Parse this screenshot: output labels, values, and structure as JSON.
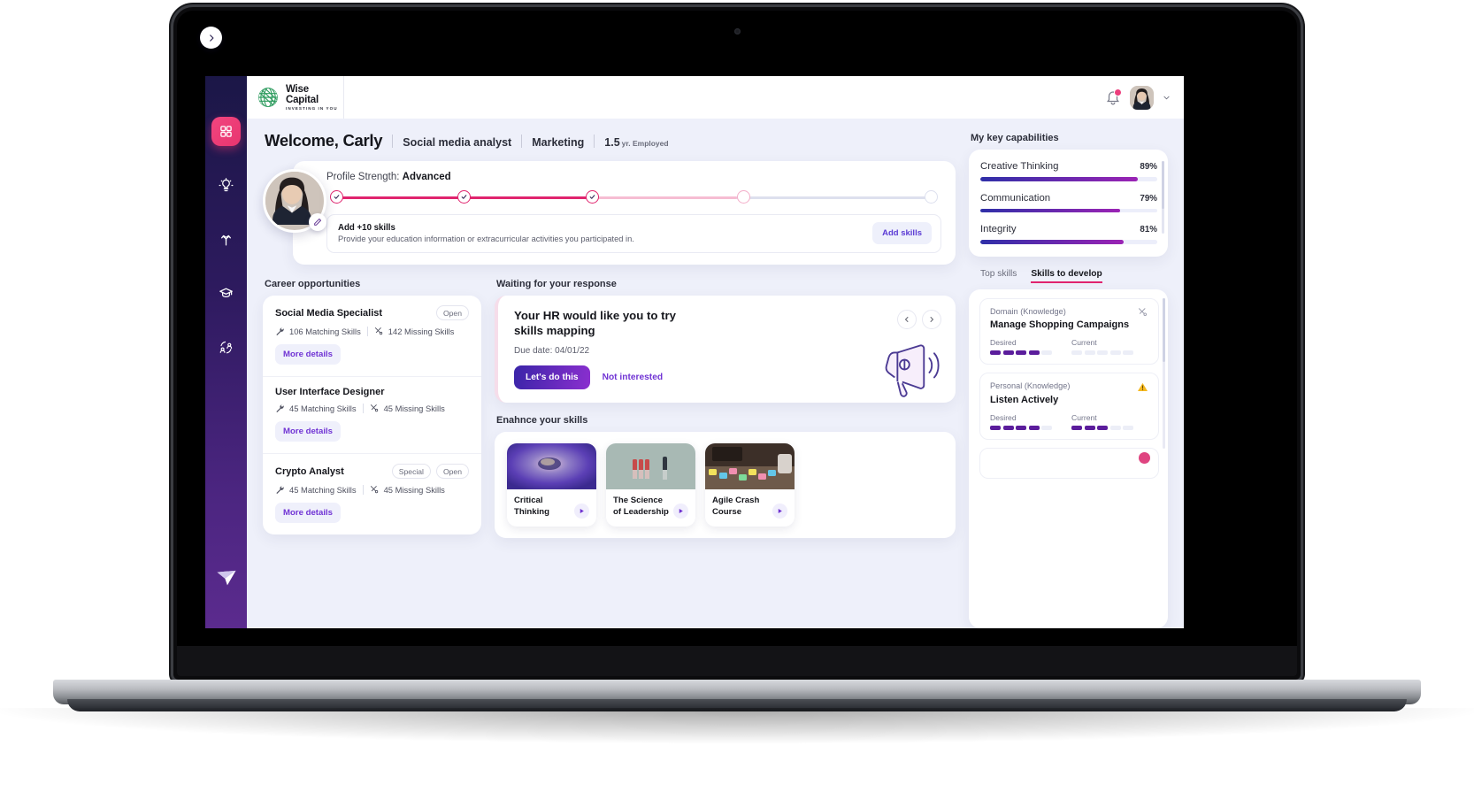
{
  "brand": {
    "name": "Wise Capital",
    "tagline": "INVESTING IN YOU"
  },
  "sidebar": {
    "items": [
      {
        "name": "dashboard",
        "icon": "grid-icon",
        "active": true
      },
      {
        "name": "insights",
        "icon": "lightbulb-icon",
        "active": false
      },
      {
        "name": "career-paths",
        "icon": "branch-icon",
        "active": false
      },
      {
        "name": "learning",
        "icon": "graduation-cap-icon",
        "active": false
      },
      {
        "name": "network",
        "icon": "people-network-icon",
        "active": false
      }
    ],
    "logo_icon": "send-logo-icon",
    "collapse_icon": "chevron-right-icon"
  },
  "header": {
    "notification_icon": "bell-icon",
    "has_notification": true,
    "avatar_icon": "user-avatar",
    "chevron_icon": "chevron-down-icon"
  },
  "welcome": {
    "greeting": "Welcome, Carly",
    "role": "Social media analyst",
    "department": "Marketing",
    "tenure_value": "1.5",
    "tenure_label": "yr. Employed"
  },
  "profile_strength": {
    "label": "Profile Strength:",
    "level": "Advanced",
    "steps": [
      {
        "state": "done"
      },
      {
        "state": "done"
      },
      {
        "state": "done"
      },
      {
        "state": "next"
      },
      {
        "state": "todo"
      }
    ],
    "prompt_title": "Add +10 skills",
    "prompt_text": "Provide your education information or extracurricular activities you participated in.",
    "cta": "Add skills",
    "edit_icon": "pencil-icon"
  },
  "career": {
    "section_title": "Career opportunities",
    "jobs": [
      {
        "title": "Social Media Specialist",
        "badges": [
          "Open"
        ],
        "matching": "106 Matching Skills",
        "missing": "142 Missing Skills",
        "cta": "More details"
      },
      {
        "title": "User Interface Designer",
        "badges": [],
        "matching": "45 Matching Skills",
        "missing": "45 Missing Skills",
        "cta": "More details"
      },
      {
        "title": "Crypto Analyst",
        "badges": [
          "Special",
          "Open"
        ],
        "matching": "45 Matching Skills",
        "missing": "45 Missing Skills",
        "cta": "More details"
      }
    ]
  },
  "waiting": {
    "section_title": "Waiting for your response",
    "title": "Your HR would like you to try skills mapping",
    "due": "Due date: 04/01/22",
    "primary_cta": "Let's do this",
    "secondary_cta": "Not interested",
    "prev_icon": "chevron-left-icon",
    "next_icon": "chevron-right-icon",
    "illustration": "megaphone-icon"
  },
  "enhance": {
    "section_title": "Enahnce your skills",
    "courses": [
      {
        "title": "Critical Thinking",
        "play_icon": "play-icon"
      },
      {
        "title": "The Science of Leadership",
        "play_icon": "play-icon"
      },
      {
        "title": "Agile Crash Course",
        "play_icon": "play-icon"
      }
    ]
  },
  "capabilities": {
    "section_title": "My key capabilities",
    "items": [
      {
        "name": "Creative Thinking",
        "pct": "89%",
        "value": 89
      },
      {
        "name": "Communication",
        "pct": "79%",
        "value": 79
      },
      {
        "name": "Integrity",
        "pct": "81%",
        "value": 81
      }
    ]
  },
  "skills_panel": {
    "tabs": [
      {
        "label": "Top skills",
        "active": false
      },
      {
        "label": "Skills to develop",
        "active": true
      }
    ],
    "desired_label": "Desired",
    "current_label": "Current",
    "items": [
      {
        "category": "Domain (Knowledge)",
        "name": "Manage Shopping Campaigns",
        "status_icon": "tools-icon",
        "desired": 4,
        "current": 0,
        "total": 5
      },
      {
        "category": "Personal (Knowledge)",
        "name": "Listen Actively",
        "status_icon": "warning-icon",
        "desired": 4,
        "current": 3,
        "total": 5
      }
    ]
  },
  "colors": {
    "accent_pink": "#e0246e",
    "accent_purple": "#7033d4",
    "rail_top": "#1b1747",
    "rail_bottom": "#5b2b8e",
    "bg": "#eef0fa"
  }
}
